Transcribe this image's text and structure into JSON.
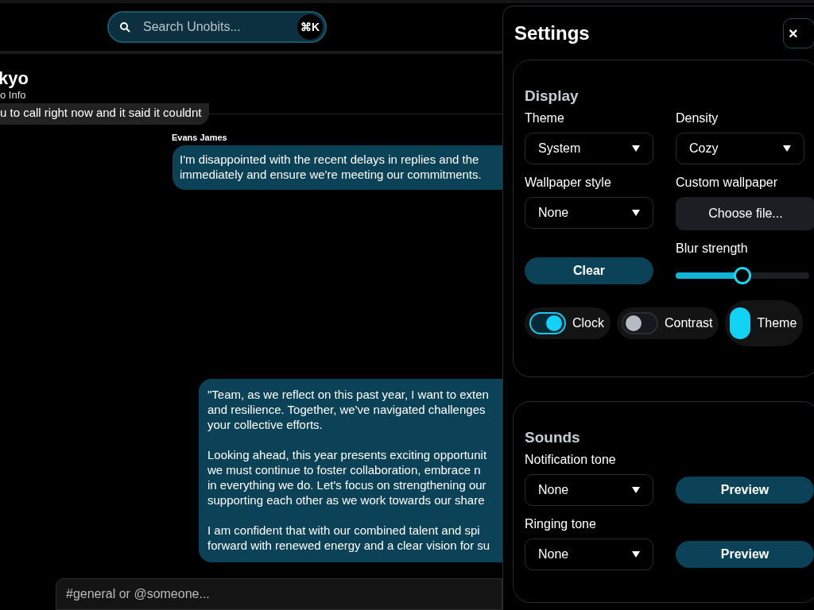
{
  "search": {
    "placeholder": "Search Unobits...",
    "shortcut": "⌘K"
  },
  "chat_header": {
    "title": "kyo",
    "subtitle": "o Info"
  },
  "messages": [
    {
      "kind": "received",
      "paragraphs": [
        [
          "u to call right now and it said it couldnt"
        ]
      ]
    },
    {
      "kind": "sent",
      "author": "Evans James",
      "paragraphs": [
        [
          "I'm disappointed with the recent delays in replies and the",
          "immediately and ensure we're meeting our commitments."
        ]
      ]
    },
    {
      "kind": "sent",
      "paragraphs": [
        [
          "\"Team, as we reflect on this past year, I want to exten",
          "and resilience. Together, we've navigated challenges",
          "your collective efforts."
        ],
        [
          "Looking ahead, this year presents exciting opportunit",
          "we must continue to foster collaboration, embrace n",
          "in everything we do. Let's focus on strengthening our",
          "supporting each other as we work towards our share"
        ],
        [
          "I am confident that with our combined talent and spi",
          "forward with renewed energy and a clear vision for su"
        ]
      ]
    }
  ],
  "composer": {
    "placeholder": "#general or @someone..."
  },
  "settings": {
    "title": "Settings",
    "close": "×",
    "display": {
      "heading": "Display",
      "theme": {
        "label": "Theme",
        "value": "System"
      },
      "density": {
        "label": "Density",
        "value": "Cozy"
      },
      "wallpaper_style": {
        "label": "Wallpaper style",
        "value": "None"
      },
      "custom_wallpaper": {
        "label": "Custom wallpaper",
        "button": "Choose file..."
      },
      "clear": "Clear",
      "blur": {
        "label": "Blur strength",
        "level": 0.5
      },
      "toggles": [
        {
          "kind": "switch",
          "label": "Clock",
          "on": true
        },
        {
          "kind": "switch",
          "label": "Contrast",
          "on": false
        },
        {
          "kind": "tall",
          "label": "Theme",
          "on": true
        }
      ]
    },
    "sounds": {
      "heading": "Sounds",
      "rows": [
        {
          "label": "Notification tone",
          "value": "None",
          "button": "Preview"
        },
        {
          "label": "Ringing tone",
          "value": "None",
          "button": "Preview"
        }
      ]
    }
  }
}
